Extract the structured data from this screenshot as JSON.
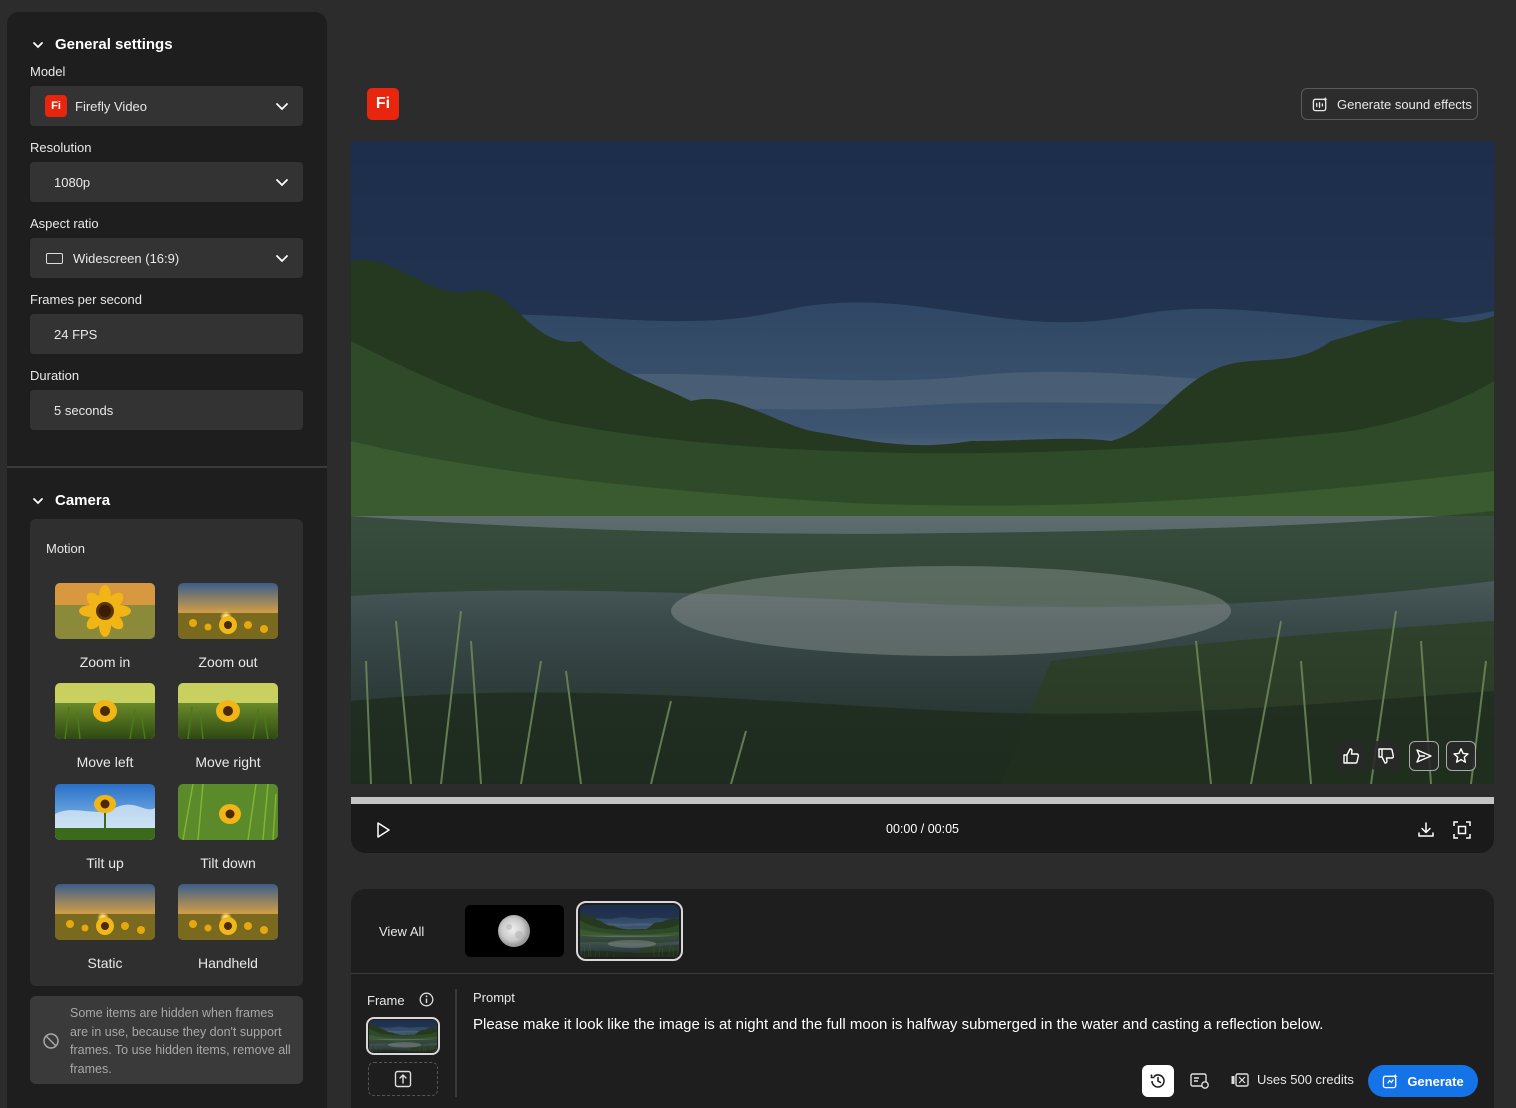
{
  "sidebar": {
    "general": {
      "title": "General settings",
      "model_label": "Model",
      "model_value": "Firefly Video",
      "model_badge": "Fi",
      "resolution_label": "Resolution",
      "resolution_value": "1080p",
      "aspect_label": "Aspect ratio",
      "aspect_value": "Widescreen (16:9)",
      "fps_label": "Frames per second",
      "fps_value": "24 FPS",
      "duration_label": "Duration",
      "duration_value": "5 seconds"
    },
    "camera": {
      "title": "Camera",
      "motion_label": "Motion",
      "items": [
        {
          "label": "Zoom in"
        },
        {
          "label": "Zoom out"
        },
        {
          "label": "Move left"
        },
        {
          "label": "Move right"
        },
        {
          "label": "Tilt up"
        },
        {
          "label": "Tilt down"
        },
        {
          "label": "Static"
        },
        {
          "label": "Handheld"
        }
      ]
    },
    "notice": "Some items are hidden when frames are in use, because they don't support frames. To use hidden items, remove all frames."
  },
  "header": {
    "logo": "Fi",
    "sound_button": "Generate sound effects"
  },
  "player": {
    "time": "00:00 / 00:05",
    "progress": 0
  },
  "history": {
    "view_all": "View All"
  },
  "composer": {
    "frame_label": "Frame",
    "prompt_label": "Prompt",
    "prompt_text": "Please make it look like the image is at night and the full moon is halfway submerged in the water and casting a reflection below.",
    "credits": "Uses 500 credits",
    "generate": "Generate"
  },
  "colors": {
    "accent": "#1473e6",
    "brand": "#e8260d",
    "panel": "#1e1e1e",
    "background": "#2c2c2c"
  }
}
